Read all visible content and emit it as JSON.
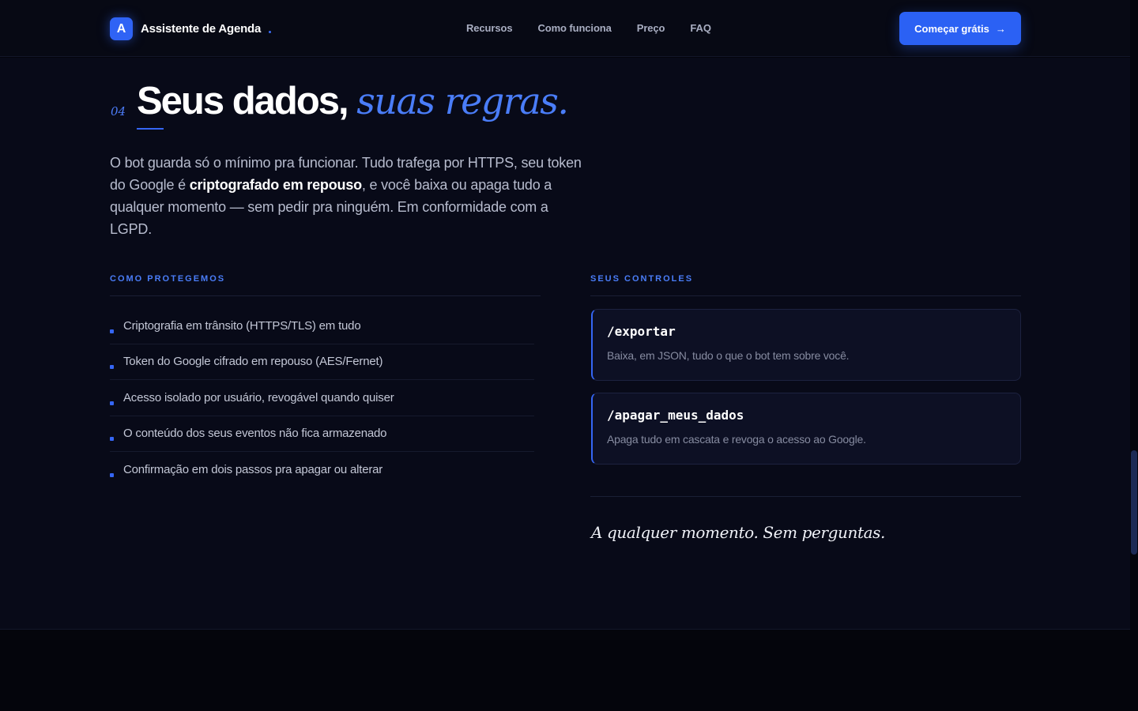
{
  "nav": {
    "logo_letter": "A",
    "brand": "Assistente de Agenda",
    "links": [
      "Recursos",
      "Como funciona",
      "Preço",
      "FAQ"
    ],
    "cta_label": "Começar grátis",
    "cta_arrow": "→"
  },
  "section": {
    "number": "04",
    "title_main": "Seus dados,",
    "title_accent": "suas regras.",
    "lead_before": "O bot guarda só o mínimo pra funcionar. Tudo trafega por HTTPS, seu token do Google é ",
    "lead_strong": "criptografado em repouso",
    "lead_after": ", e você baixa ou apaga tudo a qualquer momento — sem pedir pra ninguém. Em conformidade com a LGPD.",
    "protect": {
      "label": "COMO PROTEGEMOS",
      "items": [
        "Criptografia em trânsito (HTTPS/TLS) em tudo",
        "Token do Google cifrado em repouso (AES/Fernet)",
        "Acesso isolado por usuário, revogável quando quiser",
        "O conteúdo dos seus eventos não fica armazenado",
        "Confirmação em dois passos pra apagar ou alterar"
      ]
    },
    "controls": {
      "label": "SEUS CONTROLES",
      "cards": [
        {
          "command": "/exportar",
          "description": "Baixa, em JSON, tudo o que o bot tem sobre você."
        },
        {
          "command": "/apagar_meus_dados",
          "description": "Apaga tudo em cascata e revoga o acesso ao Google."
        }
      ],
      "tagline": "A qualquer momento. Sem perguntas."
    }
  },
  "colors": {
    "accent": "#3566f5",
    "background": "#080a18",
    "card": "#0d1024"
  }
}
